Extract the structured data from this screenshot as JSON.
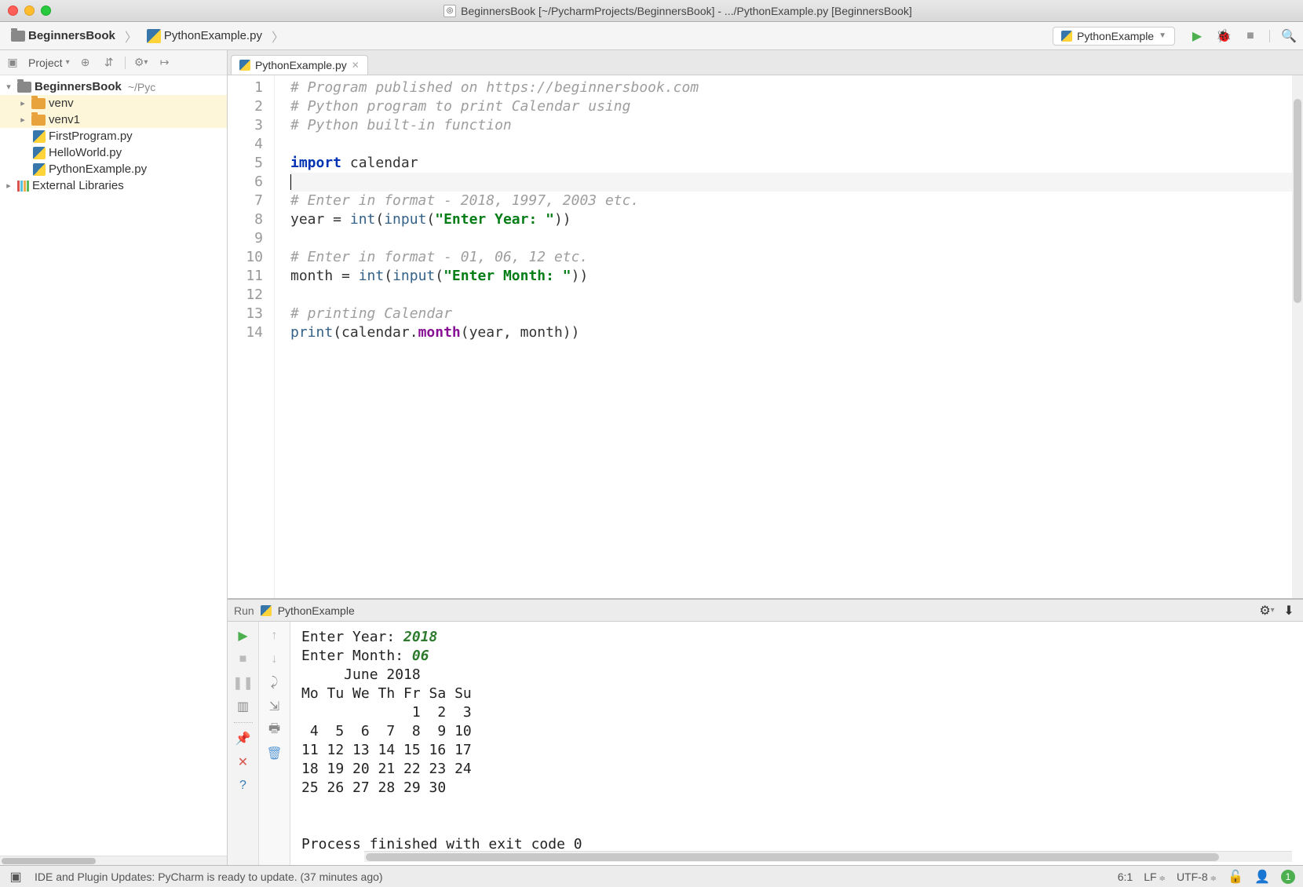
{
  "titlebar": {
    "title": "BeginnersBook [~/PycharmProjects/BeginnersBook] - .../PythonExample.py [BeginnersBook]"
  },
  "breadcrumb": {
    "project": "BeginnersBook",
    "file": "PythonExample.py"
  },
  "run_config": {
    "name": "PythonExample"
  },
  "sidebar": {
    "header": "Project",
    "root": {
      "name": "BeginnersBook",
      "path": "~/Pyc"
    },
    "items": [
      {
        "name": "venv"
      },
      {
        "name": "venv1"
      },
      {
        "name": "FirstProgram.py"
      },
      {
        "name": "HelloWorld.py"
      },
      {
        "name": "PythonExample.py"
      }
    ],
    "external": "External Libraries"
  },
  "tab": {
    "name": "PythonExample.py"
  },
  "code": {
    "lines": [
      "1",
      "2",
      "3",
      "4",
      "5",
      "6",
      "7",
      "8",
      "9",
      "10",
      "11",
      "12",
      "13",
      "14"
    ],
    "l1": "# Program published on https://beginnersbook.com",
    "l2": "# Python program to print Calendar using",
    "l3": "# Python built-in function",
    "l5_kw": "import",
    "l5_mod": " calendar",
    "l7": "# Enter in format - 2018, 1997, 2003 etc.",
    "l8_a": "year = ",
    "l8_int": "int",
    "l8_p1": "(",
    "l8_input": "input",
    "l8_p2": "(",
    "l8_str": "\"Enter Year: \"",
    "l8_end": "))",
    "l10": "# Enter in format - 01, 06, 12 etc.",
    "l11_a": "month = ",
    "l11_int": "int",
    "l11_p1": "(",
    "l11_input": "input",
    "l11_p2": "(",
    "l11_str": "\"Enter Month: \"",
    "l11_end": "))",
    "l13": "# printing Calendar",
    "l14_print": "print",
    "l14_a": "(calendar.",
    "l14_month": "month",
    "l14_b": "(year, month))"
  },
  "run": {
    "label": "Run",
    "name": "PythonExample",
    "out_year_label": "Enter Year: ",
    "out_year_val": "2018",
    "out_month_label": "Enter Month: ",
    "out_month_val": "06",
    "cal_header": "     June 2018",
    "cal_days": "Mo Tu We Th Fr Sa Su",
    "cal_r1": "             1  2  3",
    "cal_r2": " 4  5  6  7  8  9 10",
    "cal_r3": "11 12 13 14 15 16 17",
    "cal_r4": "18 19 20 21 22 23 24",
    "cal_r5": "25 26 27 28 29 30",
    "exit": "Process finished with exit code 0"
  },
  "status": {
    "msg": "IDE and Plugin Updates: PyCharm is ready to update. (37 minutes ago)",
    "pos": "6:1",
    "line_sep": "LF",
    "encoding": "UTF-8",
    "badge": "1"
  }
}
